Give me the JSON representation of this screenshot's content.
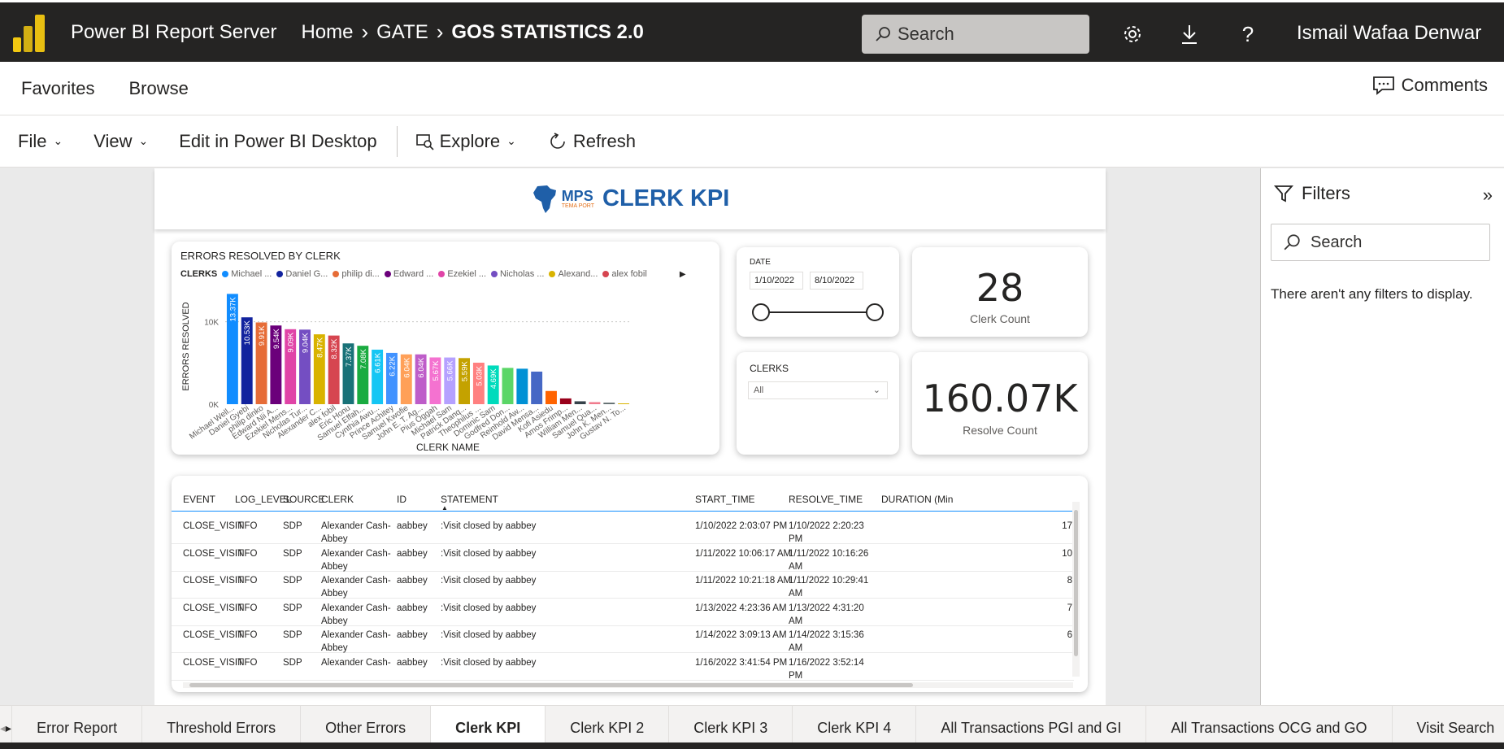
{
  "topbar": {
    "app_title": "Power BI Report Server",
    "breadcrumbs": [
      "Home",
      "GATE",
      "GOS STATISTICS 2.0"
    ],
    "search_placeholder": "Search",
    "username": "Ismail Wafaa Denwar"
  },
  "nav": {
    "favorites": "Favorites",
    "browse": "Browse",
    "comments": "Comments"
  },
  "toolbar": {
    "file": "File",
    "view": "View",
    "edit": "Edit in Power BI Desktop",
    "explore": "Explore",
    "refresh": "Refresh"
  },
  "report": {
    "logo_text": "MPS",
    "logo_sub": "TEMA PORT",
    "title": "CLERK KPI"
  },
  "chart_data": {
    "type": "bar",
    "title": "ERRORS RESOLVED BY CLERK",
    "xlabel": "CLERK NAME",
    "ylabel": "ERRORS RESOLVED",
    "legend_label": "CLERKS",
    "legend": [
      {
        "name": "Michael ...",
        "color": "#118dff"
      },
      {
        "name": "Daniel G...",
        "color": "#12239e"
      },
      {
        "name": "philip di...",
        "color": "#e66c37"
      },
      {
        "name": "Edward ...",
        "color": "#6b007b"
      },
      {
        "name": "Ezekiel ...",
        "color": "#e044a7"
      },
      {
        "name": "Nicholas ...",
        "color": "#744ec2"
      },
      {
        "name": "Alexand...",
        "color": "#d9b300"
      },
      {
        "name": "alex fobil",
        "color": "#d64550"
      }
    ],
    "y_ticks": [
      "10K",
      "0K"
    ],
    "ylim": [
      0,
      14000
    ],
    "categories": [
      "Michael Well...",
      "Daniel Gyebi",
      "philip dinko",
      "Edward Nii A...",
      "Ezekiel Mens...",
      "Nicholas Tur...",
      "Alexander C...",
      "alex fobil",
      "Eric Honu",
      "Samuel Effah...",
      "Cynthia Awu...",
      "Prince Achitey",
      "Samuel Kwofie",
      "John E. T. Ag...",
      "Pius Oggah",
      "Michael Sam",
      "Patrick Danq...",
      "Theophilus ...",
      "Dominic Sam",
      "Godfred Don...",
      "Reinhold Aw...",
      "David Mensa...",
      "Kofi Asiedu",
      "Amos Frimp...",
      "William Men...",
      "Samuel Qua...",
      "John K. Men...",
      "Gustav N. To..."
    ],
    "values": [
      13370,
      10530,
      9910,
      9540,
      9090,
      9040,
      8470,
      8320,
      7370,
      7080,
      6610,
      6220,
      6040,
      6040,
      5670,
      5660,
      5590,
      5030,
      4690,
      4400,
      4300,
      3950,
      1600,
      700,
      350,
      250,
      180,
      100
    ],
    "labels": [
      "13.37K",
      "10.53K",
      "9.91K",
      "9.54K",
      "9.09K",
      "9.04K",
      "8.47K",
      "8.32K",
      "7.37K",
      "7.08K",
      "6.61K",
      "6.22K",
      "6.04K",
      "6.04K",
      "5.67K",
      "5.66K",
      "5.59K",
      "5.03K",
      "4.69K",
      "",
      "",
      "",
      "",
      "",
      "",
      "",
      "",
      ""
    ],
    "colors": [
      "#118dff",
      "#12239e",
      "#e66c37",
      "#6b007b",
      "#e044a7",
      "#744ec2",
      "#d9b300",
      "#d64550",
      "#197278",
      "#1aab40",
      "#15c6f4",
      "#4092ff",
      "#ffa058",
      "#be5dc9",
      "#f472d0",
      "#b5a1ff",
      "#c4a200",
      "#ff8080",
      "#00dbbc",
      "#5bd667",
      "#0091d5",
      "#4668c5",
      "#ff6300",
      "#99001a",
      "#35424a",
      "#f07b8d",
      "#5f6b6d",
      "#d9b300"
    ]
  },
  "date_slicer": {
    "title": "DATE",
    "start": "1/10/2022",
    "end": "8/10/2022"
  },
  "clerk_count": {
    "value": "28",
    "label": "Clerk Count"
  },
  "clerks_slicer": {
    "title": "CLERKS",
    "selected": "All"
  },
  "resolve_count": {
    "value": "160.07K",
    "label": "Resolve Count"
  },
  "table": {
    "headers": [
      "EVENT",
      "LOG_LEVEL",
      "SOURCE",
      "CLERK",
      "ID",
      "STATEMENT",
      "START_TIME",
      "RESOLVE_TIME",
      "DURATION (Min"
    ],
    "rows": [
      [
        "CLOSE_VISIT",
        "INFO",
        "SDP",
        "Alexander Cash-Abbey",
        "aabbey",
        ":Visit closed by aabbey",
        "1/10/2022 2:03:07 PM",
        "1/10/2022 2:20:23 PM",
        "17"
      ],
      [
        "CLOSE_VISIT",
        "INFO",
        "SDP",
        "Alexander Cash-Abbey",
        "aabbey",
        ":Visit closed by aabbey",
        "1/11/2022 10:06:17 AM",
        "1/11/2022 10:16:26 AM",
        "10"
      ],
      [
        "CLOSE_VISIT",
        "INFO",
        "SDP",
        "Alexander Cash-Abbey",
        "aabbey",
        ":Visit closed by aabbey",
        "1/11/2022 10:21:18 AM",
        "1/11/2022 10:29:41 AM",
        "8"
      ],
      [
        "CLOSE_VISIT",
        "INFO",
        "SDP",
        "Alexander Cash-Abbey",
        "aabbey",
        ":Visit closed by aabbey",
        "1/13/2022 4:23:36 AM",
        "1/13/2022 4:31:20 AM",
        "7"
      ],
      [
        "CLOSE_VISIT",
        "INFO",
        "SDP",
        "Alexander Cash-Abbey",
        "aabbey",
        ":Visit closed by aabbey",
        "1/14/2022 3:09:13 AM",
        "1/14/2022 3:15:36 AM",
        "6"
      ],
      [
        "CLOSE_VISIT",
        "INFO",
        "SDP",
        "Alexander Cash-",
        "aabbey",
        ":Visit closed by aabbey",
        "1/16/2022 3:41:54 PM",
        "1/16/2022 3:52:14 PM",
        ""
      ]
    ]
  },
  "filters": {
    "title": "Filters",
    "search_placeholder": "Search",
    "empty_message": "There aren't any filters to display."
  },
  "tabs": {
    "items": [
      "Error Report",
      "Threshold Errors",
      "Other Errors",
      "Clerk KPI",
      "Clerk KPI 2",
      "Clerk KPI 3",
      "Clerk KPI 4",
      "All Transactions PGI and GI",
      "All Transactions OCG and GO",
      "Visit Search"
    ],
    "active": "Clerk KPI"
  }
}
